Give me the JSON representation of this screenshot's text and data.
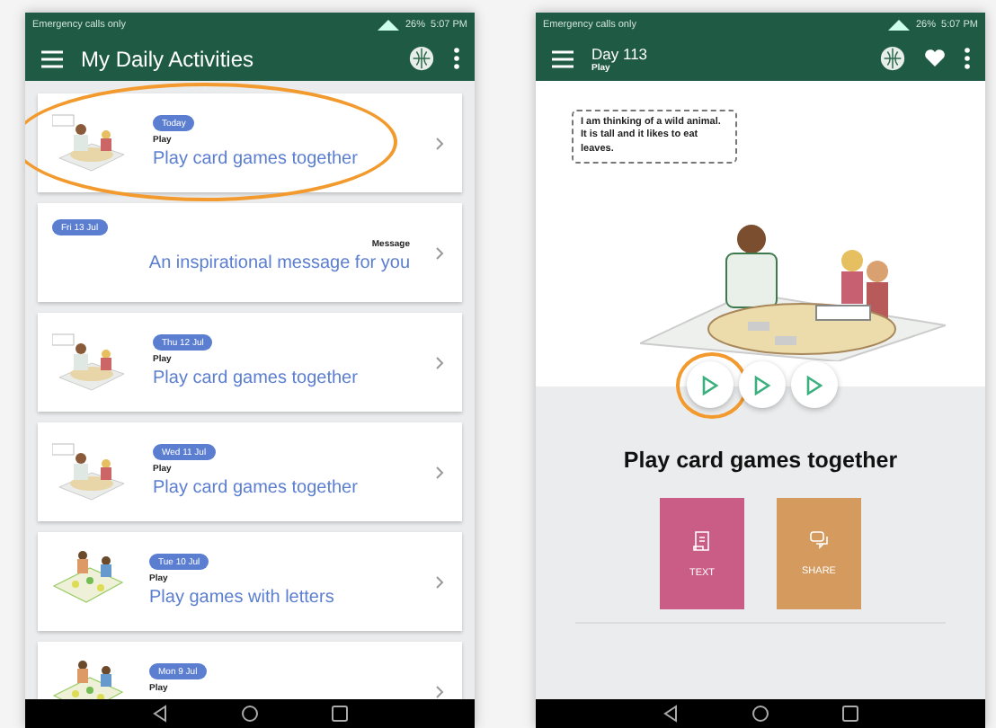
{
  "list_screen": {
    "status_bar": {
      "carrier": "Emergency calls only",
      "battery": "26%",
      "time": "5:07 PM"
    },
    "app_bar": {
      "title": "My Daily Activities"
    },
    "cards": [
      {
        "kind": "card-game",
        "badge": "Today",
        "category": "Play",
        "title": "Play card games together",
        "highlighted": true
      },
      {
        "kind": "message",
        "badge": "Fri 13 Jul",
        "category": "Message",
        "title": "An inspirational message for you",
        "highlighted": false
      },
      {
        "kind": "card-game",
        "badge": "Thu 12 Jul",
        "category": "Play",
        "title": "Play card games together",
        "highlighted": false
      },
      {
        "kind": "card-game",
        "badge": "Wed 11 Jul",
        "category": "Play",
        "title": "Play card games together",
        "highlighted": false
      },
      {
        "kind": "board-game",
        "badge": "Tue 10 Jul",
        "category": "Play",
        "title": "Play games with letters",
        "highlighted": false
      },
      {
        "kind": "board-game",
        "badge": "Mon 9 Jul",
        "category": "Play",
        "highlighted": false
      }
    ]
  },
  "detail_screen": {
    "status_bar": {
      "carrier": "Emergency calls only",
      "battery": "26%",
      "time": "5:07 PM"
    },
    "app_bar": {
      "title": "Day 113",
      "subtitle": "Play"
    },
    "speech_bubble": "I am thinking of a wild animal. It is tall and it likes to eat leaves.",
    "play_buttons": [
      {
        "highlighted": true
      },
      {
        "highlighted": false
      },
      {
        "highlighted": false
      }
    ],
    "heading": "Play card games together",
    "tiles": [
      {
        "kind": "text",
        "label": "TEXT",
        "color": "#c95d86"
      },
      {
        "kind": "share",
        "label": "SHARE",
        "color": "#d49a5e"
      }
    ]
  }
}
